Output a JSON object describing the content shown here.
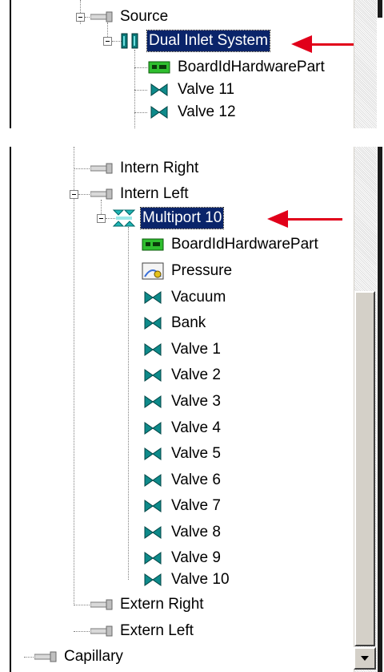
{
  "top_tree": {
    "source": "Source",
    "dual_inlet": "Dual Inlet System",
    "board": "BoardIdHardwarePart",
    "valve11": "Valve 11",
    "valve12": "Valve 12"
  },
  "bottom_tree": {
    "intern_right": "Intern Right",
    "intern_left": "Intern Left",
    "multiport": "Multiport 10",
    "board": "BoardIdHardwarePart",
    "pressure": "Pressure",
    "vacuum": "Vacuum",
    "bank": "Bank",
    "valves": [
      "Valve 1",
      "Valve 2",
      "Valve 3",
      "Valve 4",
      "Valve 5",
      "Valve 6",
      "Valve 7",
      "Valve 8",
      "Valve 9",
      "Valve 10"
    ],
    "extern_right": "Extern Right",
    "extern_left": "Extern Left",
    "capillary": "Capillary"
  },
  "icons": {
    "pipe": "pipe-icon",
    "dual_inlet": "dual-inlet-icon",
    "multiport": "multiport-icon",
    "board": "board-icon",
    "valve": "valve-icon",
    "pressure": "pressure-gauge-icon"
  },
  "colors": {
    "selection_bg": "#0a246a",
    "selection_fg": "#ffffff",
    "valve": "#0e8a8a",
    "annotation_arrow": "#e1001a"
  }
}
